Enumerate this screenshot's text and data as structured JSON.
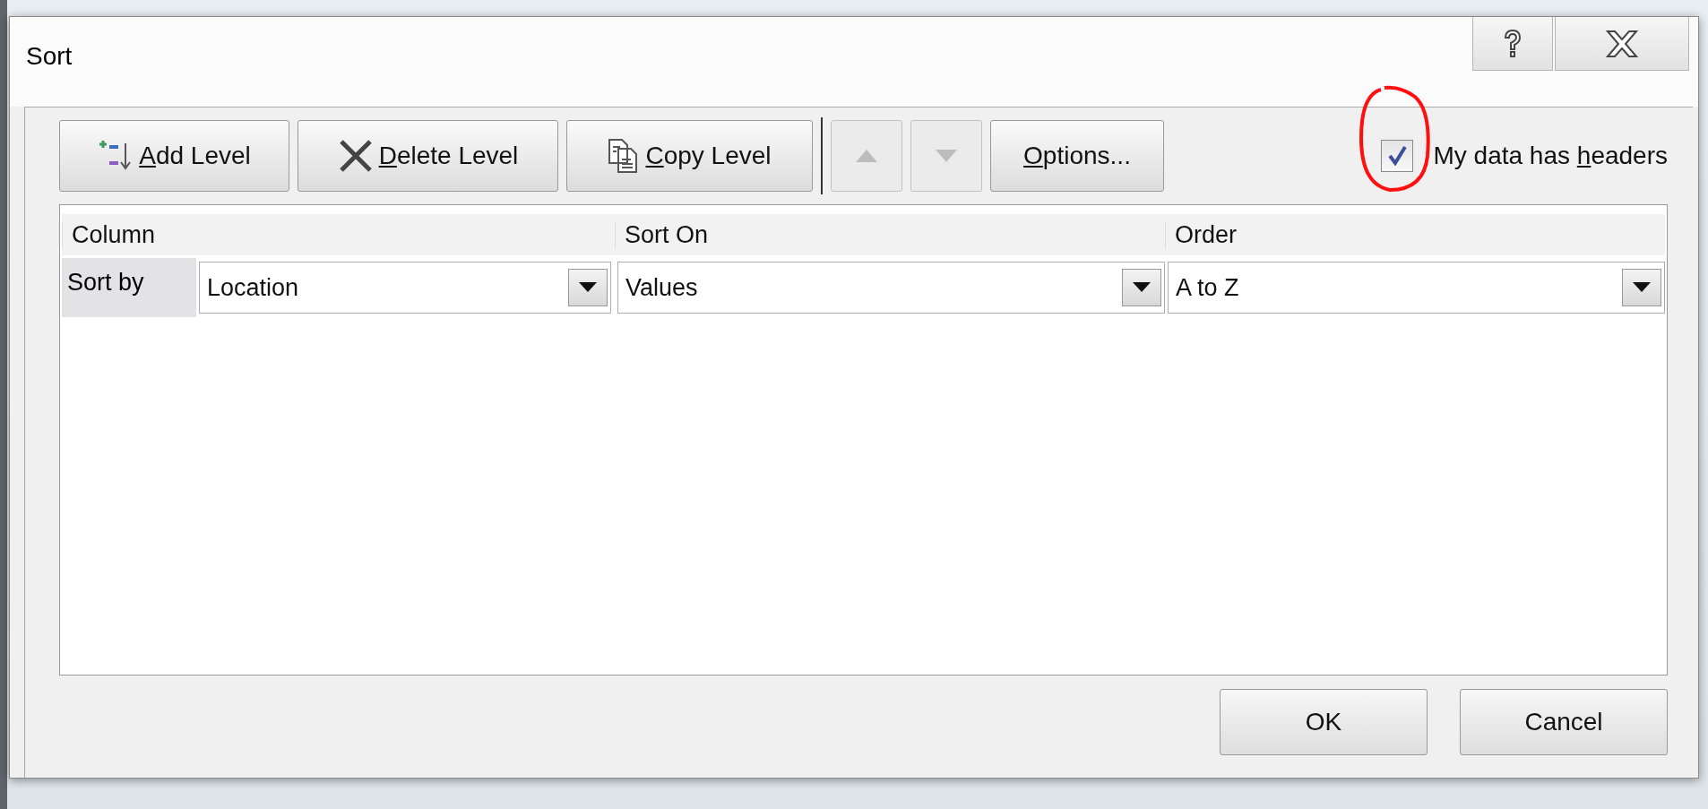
{
  "window": {
    "title": "Sort"
  },
  "toolbar": [
    {
      "kind": "add",
      "key": "A",
      "after": "dd Level",
      "disabled": false
    },
    {
      "kind": "delete",
      "key": "D",
      "after": "elete Level",
      "disabled": false
    },
    {
      "kind": "copy",
      "key": "C",
      "after": "opy Level",
      "disabled": false
    },
    {
      "kind": "up",
      "disabled": true
    },
    {
      "kind": "down",
      "disabled": true
    },
    {
      "kind": "options",
      "key": "O",
      "after": "ptions...",
      "disabled": false
    }
  ],
  "headers_checkbox": {
    "before": "My data has ",
    "key": "h",
    "after": "eaders",
    "checked": true
  },
  "annotation": {
    "kind": "freehand-circle"
  },
  "grid": {
    "columns": [
      "Column",
      "Sort On",
      "Order"
    ],
    "levels": [
      {
        "label": "Sort by",
        "column": "Location",
        "sort_on": "Values",
        "order": "A to Z",
        "selected": true
      }
    ]
  },
  "buttons": [
    "OK",
    "Cancel"
  ]
}
